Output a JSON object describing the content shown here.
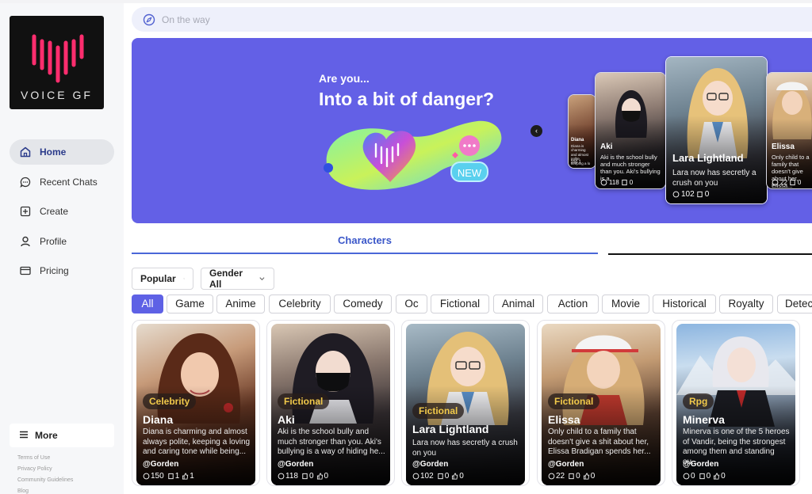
{
  "brand": {
    "name": "VOICE GF"
  },
  "nav": {
    "items": [
      {
        "label": "Home",
        "icon": "home-icon",
        "active": true
      },
      {
        "label": "Recent Chats",
        "icon": "chat-bubble-icon"
      },
      {
        "label": "Create",
        "icon": "plus-square-icon"
      },
      {
        "label": "Profile",
        "icon": "user-icon"
      },
      {
        "label": "Pricing",
        "icon": "card-icon"
      }
    ],
    "more": "More",
    "footer_links": [
      "Terms of Use",
      "Privacy Policy",
      "Community Guidelines",
      "Blog"
    ]
  },
  "search": {
    "placeholder": "On the way",
    "icon": "compass-icon"
  },
  "banner": {
    "subtitle": "Are you...",
    "title": "Into a bit of danger?",
    "badge": "NEW",
    "accent": "#6360e6",
    "cards": [
      {
        "name": "Diana",
        "desc": "Diana is charming and almost polite, keeping a lo",
        "stats": "150 1"
      },
      {
        "name": "Aki",
        "desc": "Aki is the school bully and much stronger than you. Aki's bullying is a",
        "stats": [
          "118",
          "0"
        ]
      },
      {
        "name": "Lara Lightland",
        "desc": "Lara now has secretly a crush on you",
        "stats": [
          "102",
          "0"
        ]
      },
      {
        "name": "Elissa",
        "desc": "Only child to a family that doesn't give about her, Elissa...",
        "stats": [
          "22",
          "0"
        ]
      }
    ]
  },
  "tabs": {
    "characters": "Characters"
  },
  "filters": {
    "sort": "Popular",
    "gender": "Gender All"
  },
  "categories": [
    "All",
    "Game",
    "Anime",
    "Celebrity",
    "Comedy",
    "Oc",
    "Fictional",
    "Animal",
    "Action",
    "Movie",
    "Historical",
    "Royalty",
    "Detec"
  ],
  "characters": [
    {
      "tag": "Celebrity",
      "name": "Diana",
      "desc": "Diana is charming and almost always polite, keeping a loving and caring tone while being...",
      "author": "@Gorden",
      "chats": "150",
      "saves": "1",
      "likes": "1"
    },
    {
      "tag": "Fictional",
      "name": "Aki",
      "desc": "Aki is the school bully and much stronger than you. Aki's bullying is a way of hiding he...",
      "author": "@Gorden",
      "chats": "118",
      "saves": "0",
      "likes": "0"
    },
    {
      "tag": "Fictional",
      "name": "Lara Lightland",
      "desc": "Lara now has secretly a crush on you",
      "author": "@Gorden",
      "chats": "102",
      "saves": "0",
      "likes": "0"
    },
    {
      "tag": "Fictional",
      "name": "Elissa",
      "desc": "Only child to a family that doesn't give a shit about her, Elissa Bradigan spends her...",
      "author": "@Gorden",
      "chats": "22",
      "saves": "0",
      "likes": "0"
    },
    {
      "tag": "Rpg",
      "name": "Minerva",
      "desc": "Minerva is one of the 5 heroes of Vandir, being the strongest among them and standing ou...",
      "author": "@Gorden",
      "chats": "0",
      "saves": "0",
      "likes": "0"
    }
  ]
}
